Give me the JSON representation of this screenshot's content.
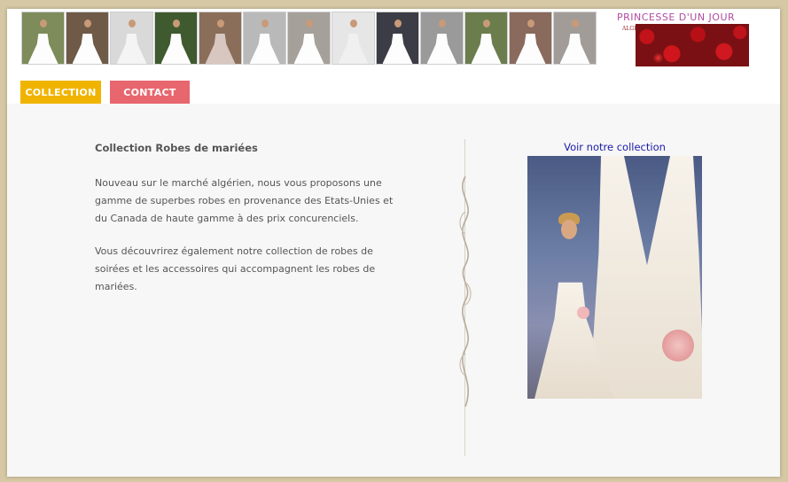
{
  "banner": {
    "logo": {
      "title": "PRINCESSE D'UN JOUR",
      "side_text": "ALGER"
    },
    "thumbnails": [
      "wedding-dress-photo-1",
      "wedding-dress-photo-2",
      "wedding-dress-photo-3",
      "wedding-dress-photo-4",
      "wedding-dress-photo-5",
      "wedding-dress-photo-6",
      "wedding-dress-photo-7",
      "wedding-dress-photo-8",
      "wedding-dress-photo-9",
      "wedding-dress-photo-10",
      "wedding-dress-photo-11",
      "wedding-dress-photo-12",
      "wedding-dress-photo-13"
    ]
  },
  "nav": {
    "collection": "COLLECTION",
    "contact": "CONTACT"
  },
  "main": {
    "heading": "Collection Robes de mariées",
    "paragraph1": "Nouveau sur le marché algérien, nous vous proposons une gamme de superbes robes en provenance des Etats-Unies et du Canada de haute gamme à des prix concurenciels.",
    "paragraph2": "Vous découvrirez également notre collection de robes de soirées et les accessoires qui accompagnent les robes de mariées.",
    "collection_link": "Voir notre collection"
  },
  "colors": {
    "collection_tab": "#f0b400",
    "contact_tab": "#e8666e",
    "link": "#1a1aa8",
    "body_text": "#555555",
    "page_bg": "#d6c8a4"
  }
}
